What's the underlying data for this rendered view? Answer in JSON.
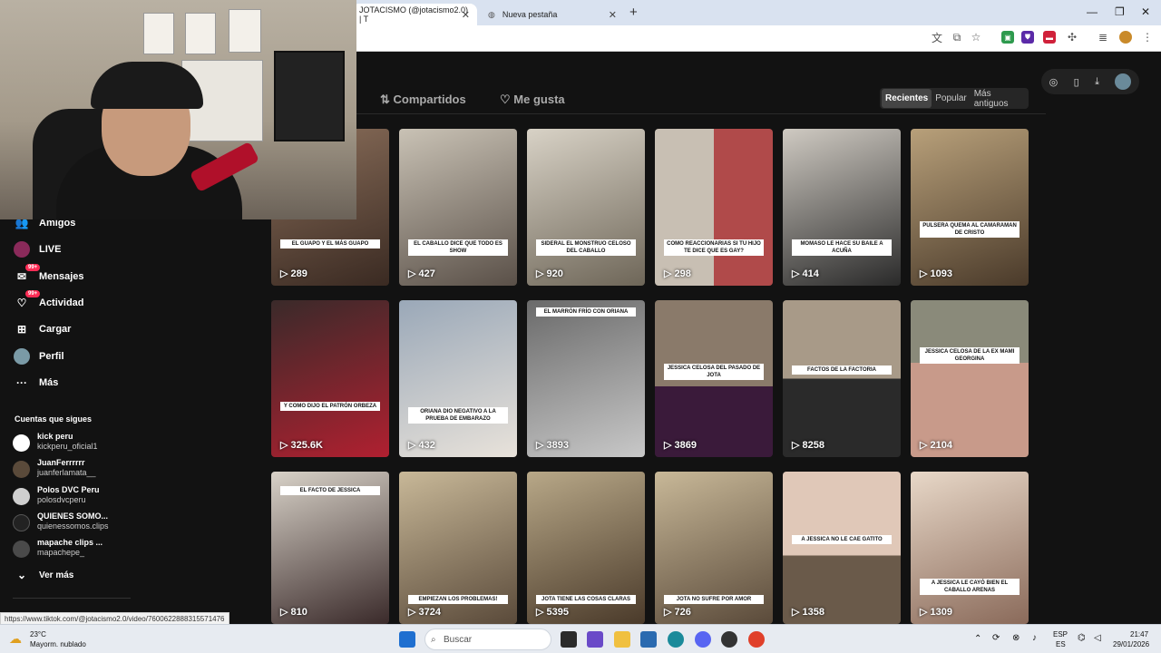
{
  "browser": {
    "tabs": [
      {
        "title": "JOTACISMO (@jotacismo2.0) | T",
        "active": true
      },
      {
        "title": "Nueva pestaña",
        "active": false
      }
    ]
  },
  "profile": {
    "tabs": [
      {
        "label": "Compartidos",
        "icon": "repost-icon"
      },
      {
        "label": "Me gusta",
        "icon": "heart-outline-icon"
      }
    ],
    "sort": [
      "Recientes",
      "Popular",
      "Más antiguos"
    ],
    "active_sort": "Recientes"
  },
  "sidebar": {
    "items": [
      {
        "label": "Amigos",
        "icon": "friends-icon"
      },
      {
        "label": "LIVE",
        "icon": "live-icon"
      },
      {
        "label": "Mensajes",
        "icon": "message-icon",
        "badge": "99+"
      },
      {
        "label": "Actividad",
        "icon": "activity-icon",
        "badge": "99+"
      },
      {
        "label": "Cargar",
        "icon": "upload-icon"
      },
      {
        "label": "Perfil",
        "icon": "profile-icon"
      },
      {
        "label": "Más",
        "icon": "more-icon"
      }
    ],
    "following_title": "Cuentas que sigues",
    "following": [
      {
        "name": "kick peru",
        "handle": "kickperu_oficial1"
      },
      {
        "name": "JuanFerrrrrr",
        "handle": "juanferlamata__"
      },
      {
        "name": "Polos DVC Peru",
        "handle": "polosdvcperu"
      },
      {
        "name": "QUIENES SOMO...",
        "handle": "quienessomos.clips"
      },
      {
        "name": "mapache clips ...",
        "handle": "mapachepe_"
      }
    ],
    "see_more": "Ver más"
  },
  "videos": [
    {
      "views": "289",
      "caption": "EL GUAPO Y EL MÁS GUAPO"
    },
    {
      "views": "427",
      "caption": "EL CABALLO DICE QUE TODO ES SHOW"
    },
    {
      "views": "920",
      "caption": "SIDERAL EL MONSTRUO CELOSO DEL CABALLO"
    },
    {
      "views": "298",
      "caption": "COMO REACCIONARIAS SI TU HIJO TE DICE QUE ES GAY?"
    },
    {
      "views": "414",
      "caption": "MOMASO LE HACE SU BAILE A ACUÑA"
    },
    {
      "views": "1093",
      "caption": "PULSERA QUEMA AL CAMARAMAN DE CRISTO"
    },
    {
      "views": "325.6K",
      "caption": "Y COMO DIJO EL PATRÓN ORBEZA"
    },
    {
      "views": "432",
      "caption": "ORIANA DIO NEGATIVO A LA PRUEBA DE EMBARAZO"
    },
    {
      "views": "3893",
      "caption": "EL MARRÓN FRÍO CON ORIANA"
    },
    {
      "views": "3869",
      "caption": "JESSICA CELOSA DEL PASADO DE JOTA"
    },
    {
      "views": "8258",
      "caption": "FACTOS DE LA FACTORIA"
    },
    {
      "views": "2104",
      "caption": "JESSICA CELOSA DE LA EX MAMI GEORGINA"
    },
    {
      "views": "810",
      "caption": "EL FACTO DE JESSICA"
    },
    {
      "views": "3724",
      "caption": "EMPIEZAN LOS PROBLEMAS!"
    },
    {
      "views": "5395",
      "caption": "JOTA TIENE LAS COSAS CLARAS"
    },
    {
      "views": "726",
      "caption": "JOTA NO SUFRE POR AMOR"
    },
    {
      "views": "1358",
      "caption": "A JESSICA NO LE CAE GATITO"
    },
    {
      "views": "1309",
      "caption": "A JESSICA LE CAYÓ BIEN EL CABALLO ARENAS"
    }
  ],
  "status_url": "https://www.tiktok.com/@jotacismo2.0/video/7600622888315571476",
  "taskbar": {
    "weather_temp": "23°C",
    "weather_desc": "Mayorm. nublado",
    "search_placeholder": "Buscar",
    "lang": "ESP",
    "lang_sub": "ES",
    "time": "21:47",
    "date": "29/01/2026"
  },
  "colors": {
    "accent": "#fe2c55",
    "background": "#121212"
  }
}
